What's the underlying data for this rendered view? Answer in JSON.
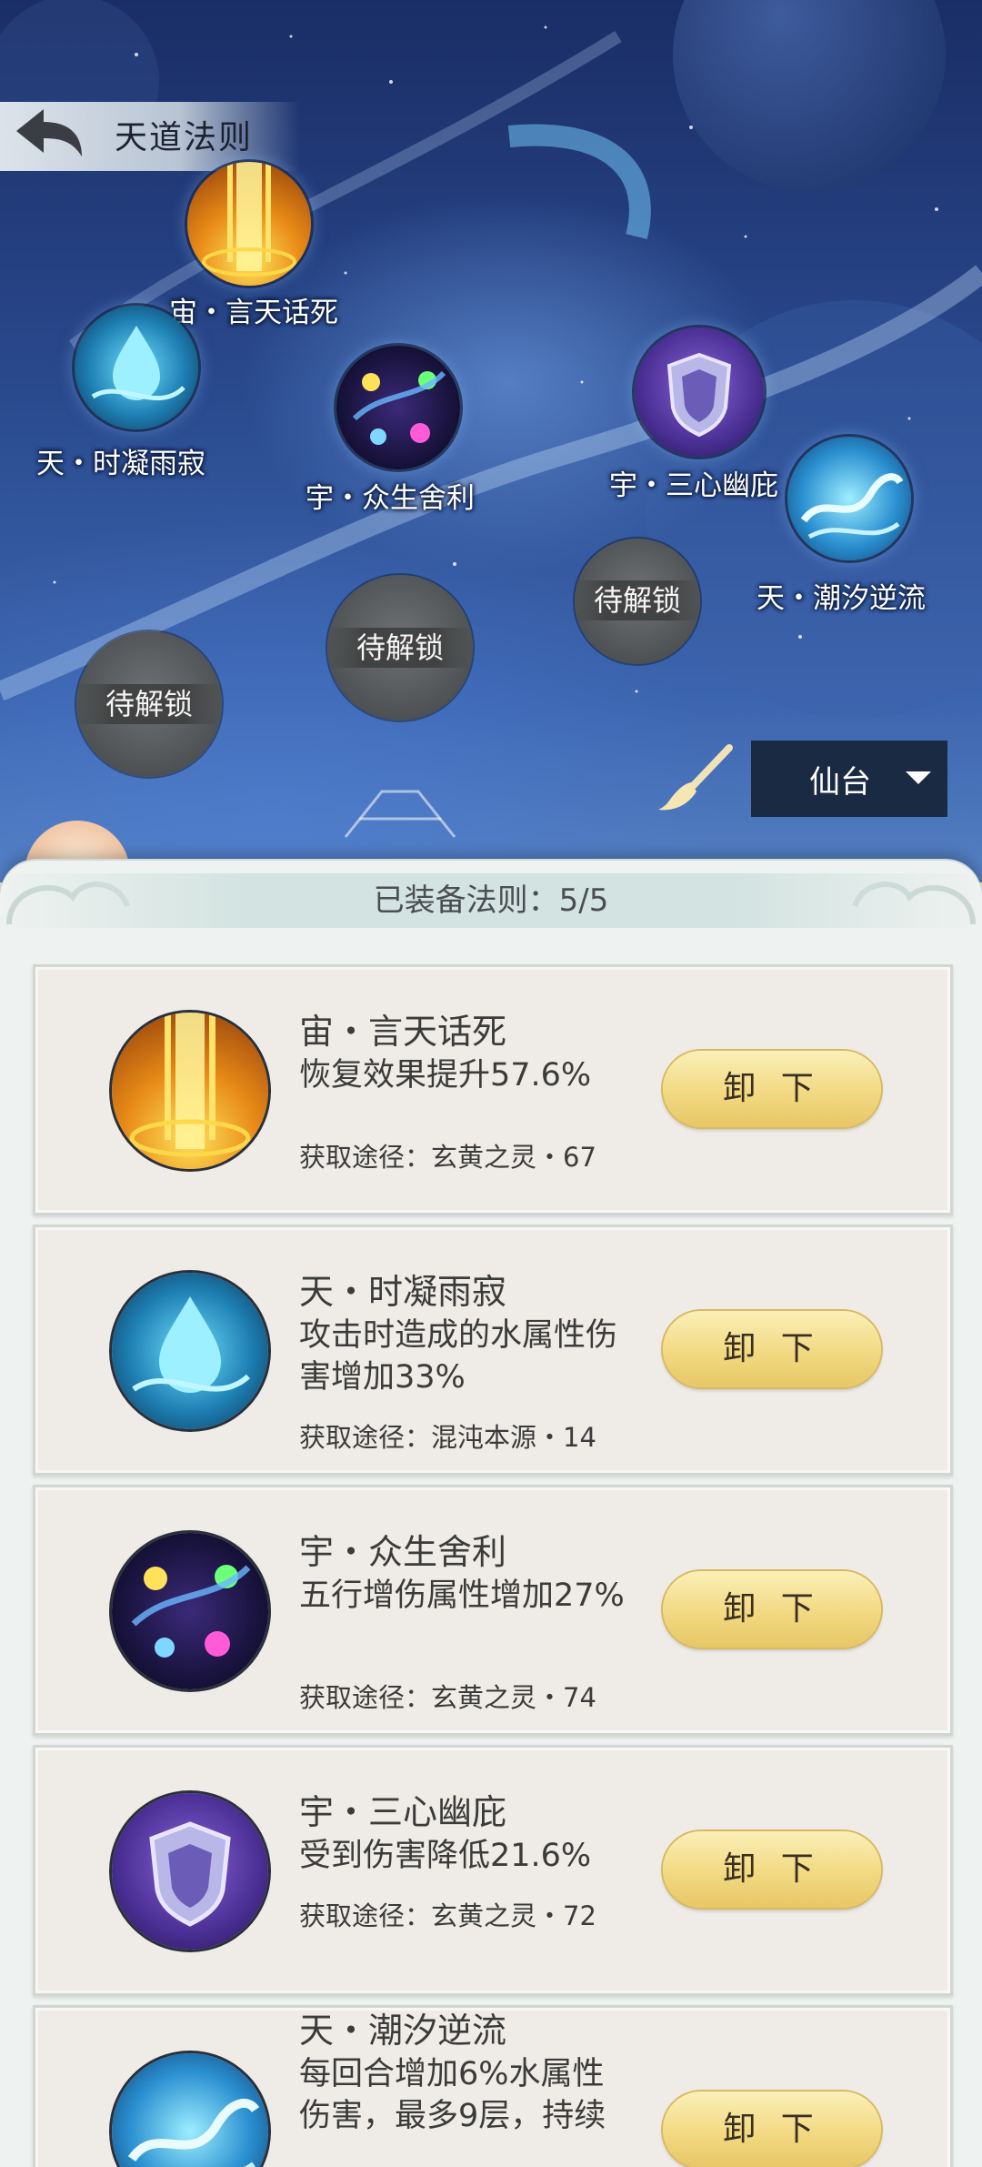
{
  "header": {
    "title": "天道法则"
  },
  "map": {
    "nodes": [
      {
        "label": "宙・言天话死",
        "icon": "golden-pillar-icon"
      },
      {
        "label": "天・时凝雨寂",
        "icon": "water-drop-icon"
      },
      {
        "label": "宇・众生舍利",
        "icon": "comet-swirl-icon"
      },
      {
        "label": "宇・三心幽庇",
        "icon": "shield-icon"
      },
      {
        "label": "天・潮汐逆流",
        "icon": "tidal-wave-icon"
      }
    ],
    "locked_label": "待解锁",
    "select": {
      "value": "仙台"
    }
  },
  "equipped": {
    "header": "已装备法则：5/5",
    "cards": [
      {
        "name": "宙・言天话死",
        "desc": "恢复效果提升57.6%",
        "source": "获取途径：玄黄之灵・67",
        "button": "卸 下"
      },
      {
        "name": "天・时凝雨寂",
        "desc": "攻击时造成的水属性伤害增加33%",
        "source": "获取途径：混沌本源・14",
        "button": "卸 下"
      },
      {
        "name": "宇・众生舍利",
        "desc": "五行增伤属性增加27%",
        "source": "获取途径：玄黄之灵・74",
        "button": "卸 下"
      },
      {
        "name": "宇・三心幽庇",
        "desc": "受到伤害降低21.6%",
        "source": "获取途径：玄黄之灵・72",
        "button": "卸 下"
      },
      {
        "name": "天・潮汐逆流",
        "desc": "每回合增加6%水属性伤害，最多9层，持续",
        "source": "",
        "button": "卸 下"
      }
    ]
  },
  "colors": {
    "sky": "#2a4a8e",
    "select_bg": "#1a2a42",
    "button_gold": "#f2d982",
    "card_bg": "#efece7"
  }
}
